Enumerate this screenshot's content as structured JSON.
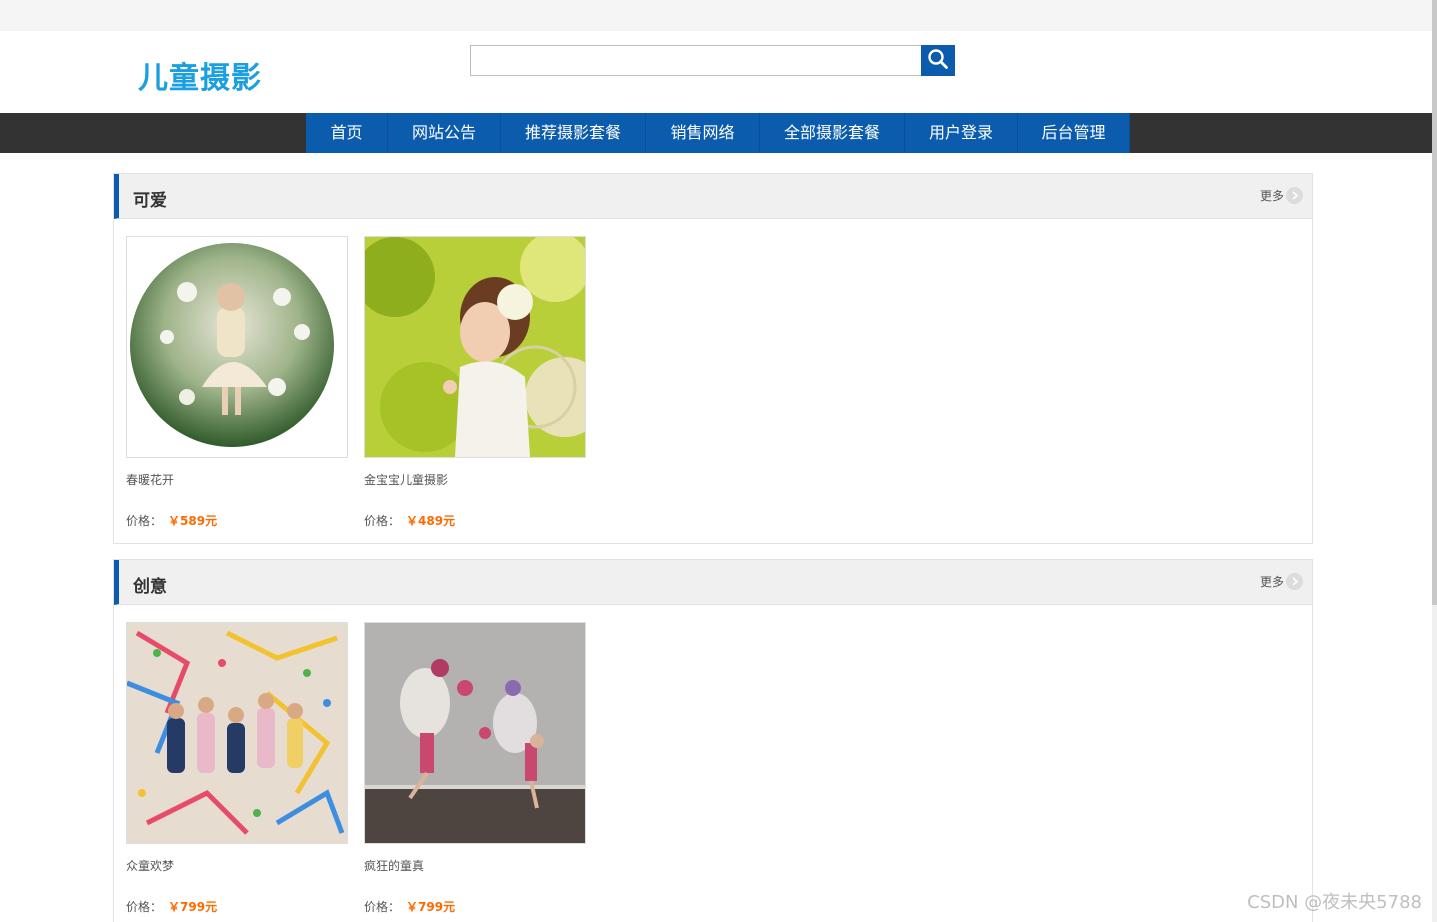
{
  "header": {
    "logo_text": "儿童摄影",
    "search": {
      "value": "",
      "placeholder": ""
    }
  },
  "nav": {
    "items": [
      {
        "label": "首页"
      },
      {
        "label": "网站公告"
      },
      {
        "label": "推荐摄影套餐"
      },
      {
        "label": "销售网络"
      },
      {
        "label": "全部摄影套餐"
      },
      {
        "label": "用户登录"
      },
      {
        "label": "后台管理"
      }
    ]
  },
  "sections": [
    {
      "title": "可爱",
      "more_label": "更多",
      "products": [
        {
          "name": "春暖花开",
          "price_label": "价格：",
          "price": "￥589元"
        },
        {
          "name": "金宝宝儿童摄影",
          "price_label": "价格：",
          "price": "￥489元"
        }
      ]
    },
    {
      "title": "创意",
      "more_label": "更多",
      "products": [
        {
          "name": "众童欢梦",
          "price_label": "价格：",
          "price": "￥799元"
        },
        {
          "name": "疯狂的童真",
          "price_label": "价格：",
          "price": "￥799元"
        }
      ]
    }
  ],
  "watermark": "CSDN @夜未央5788",
  "colors": {
    "brand_blue": "#0b5cad",
    "logo_blue": "#1a9fe0",
    "navbar_dark": "#333333",
    "price_orange": "#ff6a00"
  }
}
